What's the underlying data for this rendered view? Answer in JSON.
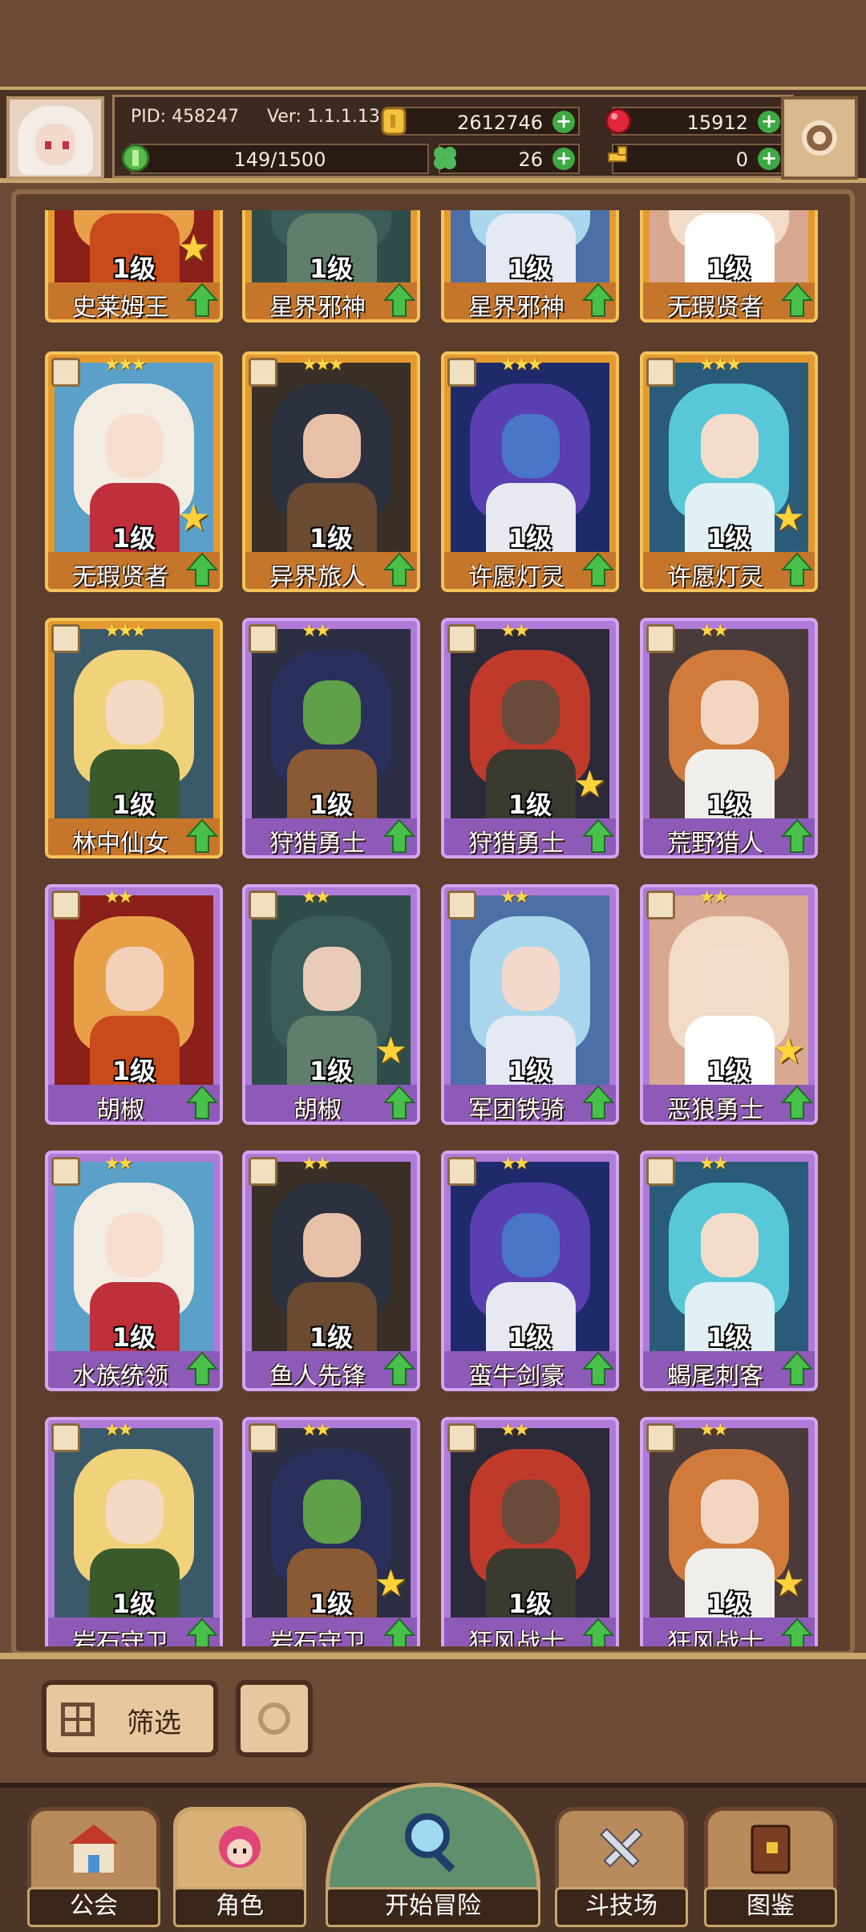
{
  "header": {
    "pid": "PID: 458247",
    "version": "Ver: 1.1.1.13",
    "gold": "2612746",
    "gems": "15912",
    "clover": "26",
    "key": "0",
    "energy": "149/1500"
  },
  "cards_partial": [
    {
      "name": "史莱姆王",
      "level": "1级",
      "rarity": "gold",
      "big_star": true
    },
    {
      "name": "星界邪神",
      "level": "1级",
      "rarity": "gold",
      "big_star": false
    },
    {
      "name": "星界邪神",
      "level": "1级",
      "rarity": "gold",
      "big_star": false
    },
    {
      "name": "无瑕贤者",
      "level": "1级",
      "rarity": "gold",
      "big_star": false
    }
  ],
  "cards": [
    {
      "name": "无瑕贤者",
      "level": "1级",
      "rarity": "gold",
      "stars": "★★★",
      "big_star": true
    },
    {
      "name": "异界旅人",
      "level": "1级",
      "rarity": "gold",
      "stars": "★★★",
      "big_star": false
    },
    {
      "name": "许愿灯灵",
      "level": "1级",
      "rarity": "gold",
      "stars": "★★★",
      "big_star": false
    },
    {
      "name": "许愿灯灵",
      "level": "1级",
      "rarity": "gold",
      "stars": "★★★",
      "big_star": true
    },
    {
      "name": "林中仙女",
      "level": "1级",
      "rarity": "gold",
      "stars": "★★★",
      "big_star": false
    },
    {
      "name": "狩猎勇士",
      "level": "1级",
      "rarity": "purple",
      "stars": "★★",
      "big_star": false
    },
    {
      "name": "狩猎勇士",
      "level": "1级",
      "rarity": "purple",
      "stars": "★★",
      "big_star": true
    },
    {
      "name": "荒野猎人",
      "level": "1级",
      "rarity": "purple",
      "stars": "★★",
      "big_star": false
    },
    {
      "name": "胡椒",
      "level": "1级",
      "rarity": "purple",
      "stars": "★★",
      "big_star": false
    },
    {
      "name": "胡椒",
      "level": "1级",
      "rarity": "purple",
      "stars": "★★",
      "big_star": true
    },
    {
      "name": "军团铁骑",
      "level": "1级",
      "rarity": "purple",
      "stars": "★★",
      "big_star": false
    },
    {
      "name": "恶狼勇士",
      "level": "1级",
      "rarity": "purple",
      "stars": "★★",
      "big_star": true
    },
    {
      "name": "水族统领",
      "level": "1级",
      "rarity": "purple",
      "stars": "★★",
      "big_star": false
    },
    {
      "name": "鱼人先锋",
      "level": "1级",
      "rarity": "purple",
      "stars": "★★",
      "big_star": false
    },
    {
      "name": "蛮牛剑豪",
      "level": "1级",
      "rarity": "purple",
      "stars": "★★",
      "big_star": false
    },
    {
      "name": "蝎尾刺客",
      "level": "1级",
      "rarity": "purple",
      "stars": "★★",
      "big_star": false
    },
    {
      "name": "岩石守卫",
      "level": "1级",
      "rarity": "purple",
      "stars": "★★",
      "big_star": false
    },
    {
      "name": "岩石守卫",
      "level": "1级",
      "rarity": "purple",
      "stars": "★★",
      "big_star": true
    },
    {
      "name": "狂风战士",
      "level": "1级",
      "rarity": "purple",
      "stars": "★★",
      "big_star": false
    },
    {
      "name": "狂风战士",
      "level": "1级",
      "rarity": "purple",
      "stars": "★★",
      "big_star": true
    }
  ],
  "toolbar": {
    "filter_label": "筛选"
  },
  "nav": {
    "guild": "公会",
    "role": "角色",
    "adventure": "开始冒险",
    "arena": "斗技场",
    "codex": "图鉴"
  },
  "colors": {
    "gold_card": "#e49a2e",
    "purple_card": "#b07ad8",
    "plus_green": "#3ea943"
  }
}
